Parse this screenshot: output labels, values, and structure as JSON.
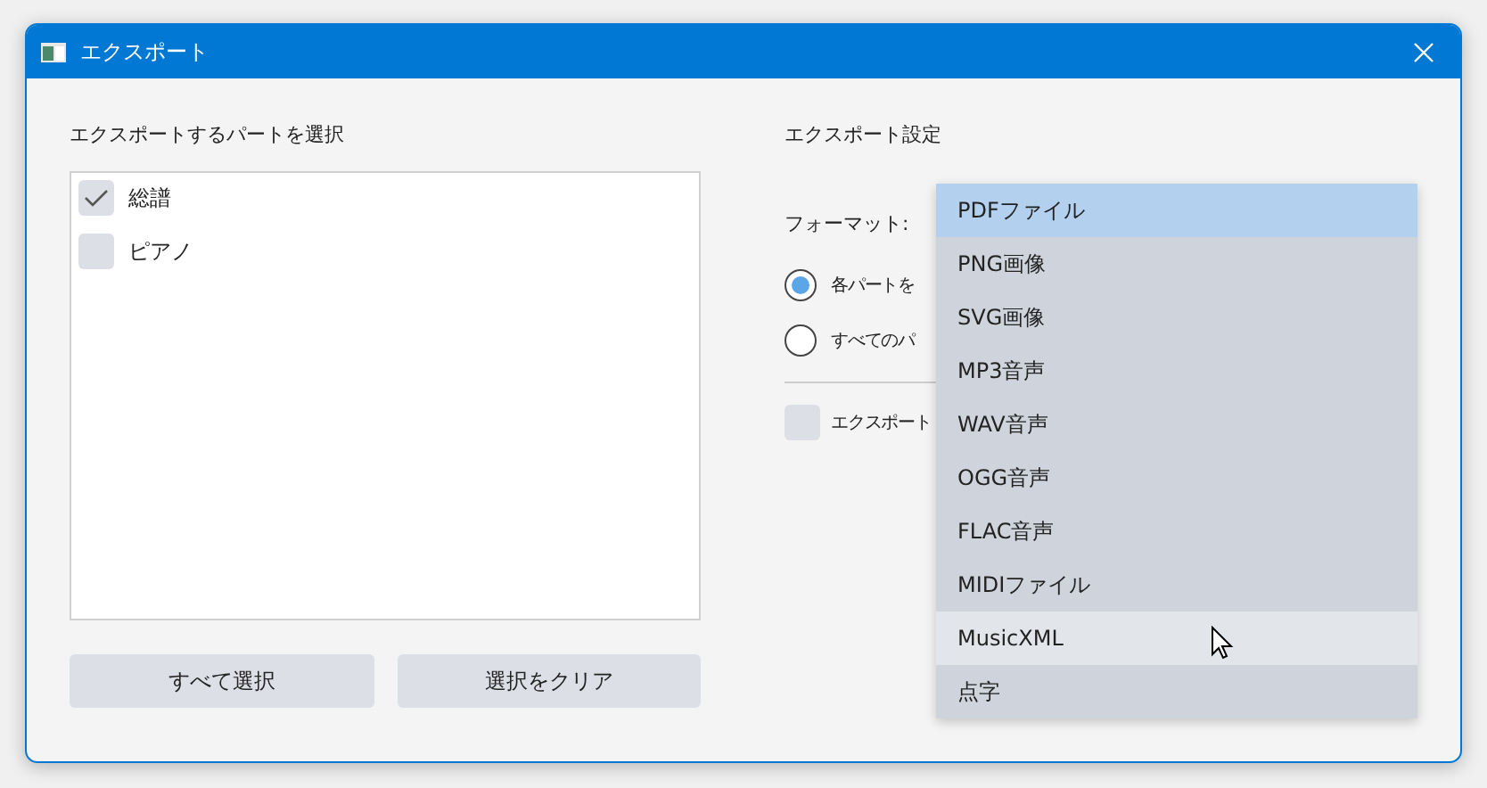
{
  "window": {
    "title": "エクスポート"
  },
  "parts_panel": {
    "heading": "エクスポートするパートを選択",
    "parts": [
      {
        "label": "総譜",
        "checked": true
      },
      {
        "label": "ピアノ",
        "checked": false
      }
    ],
    "buttons": [
      "すべて選択",
      "選択をクリア"
    ]
  },
  "settings_panel": {
    "heading": "エクスポート設定",
    "format_label": "フォーマット:",
    "radios": [
      {
        "label": "各パートを",
        "selected": true
      },
      {
        "label": "すべてのパ",
        "selected": false
      }
    ],
    "checkbox": {
      "label": "エクスポート",
      "checked": false
    },
    "format_menu": [
      {
        "label": "PDFファイル",
        "selected": true,
        "hovered": false
      },
      {
        "label": "PNG画像",
        "selected": false,
        "hovered": false
      },
      {
        "label": "SVG画像",
        "selected": false,
        "hovered": false
      },
      {
        "label": "MP3音声",
        "selected": false,
        "hovered": false
      },
      {
        "label": "WAV音声",
        "selected": false,
        "hovered": false
      },
      {
        "label": "OGG音声",
        "selected": false,
        "hovered": false
      },
      {
        "label": "FLAC音声",
        "selected": false,
        "hovered": false
      },
      {
        "label": "MIDIファイル",
        "selected": false,
        "hovered": false
      },
      {
        "label": "MusicXML",
        "selected": false,
        "hovered": true
      },
      {
        "label": "点字",
        "selected": false,
        "hovered": false
      }
    ]
  }
}
